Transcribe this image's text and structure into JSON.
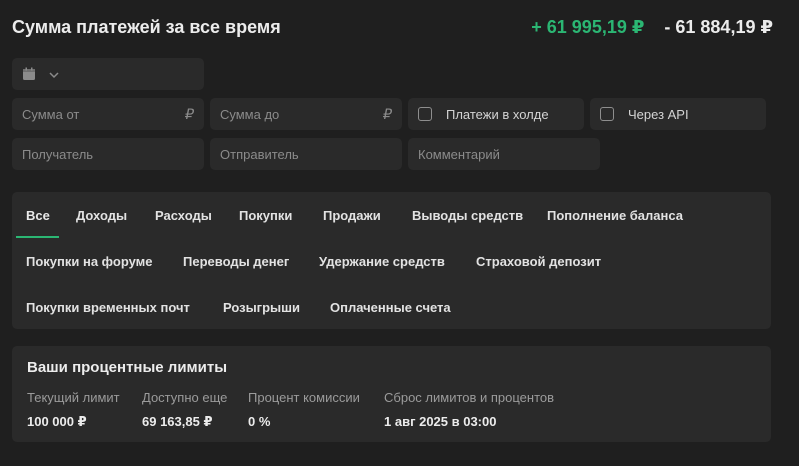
{
  "header": {
    "title": "Сумма платежей за все время",
    "income": "+ 61 995,19 ₽",
    "expense": "- 61 884,19 ₽"
  },
  "filters": {
    "date_icon": "calendar-icon",
    "chevron_icon": "chevron-down-icon",
    "amount_from": {
      "placeholder": "Сумма от",
      "suffix": "₽"
    },
    "amount_to": {
      "placeholder": "Сумма до",
      "suffix": "₽"
    },
    "hold_label": "Платежи в холде",
    "api_label": "Через API",
    "recipient": {
      "placeholder": "Получатель"
    },
    "sender": {
      "placeholder": "Отправитель"
    },
    "comment": {
      "placeholder": "Комментарий"
    }
  },
  "tabs": [
    {
      "label": "Все",
      "active": true
    },
    {
      "label": "Доходы"
    },
    {
      "label": "Расходы"
    },
    {
      "label": "Покупки"
    },
    {
      "label": "Продажи"
    },
    {
      "label": "Выводы средств"
    },
    {
      "label": "Пополнение баланса"
    },
    {
      "label": "Покупки на форуме"
    },
    {
      "label": "Переводы денег"
    },
    {
      "label": "Удержание средств"
    },
    {
      "label": "Страховой депозит"
    },
    {
      "label": "Покупки временных почт"
    },
    {
      "label": "Розыгрыши"
    },
    {
      "label": "Оплаченные счета"
    }
  ],
  "limits": {
    "title": "Ваши процентные лимиты",
    "items": [
      {
        "label": "Текущий лимит",
        "value": "100 000 ₽"
      },
      {
        "label": "Доступно еще",
        "value": "69 163,85 ₽"
      },
      {
        "label": "Процент комиссии",
        "value": "0 %"
      },
      {
        "label": "Сброс лимитов и процентов",
        "value": "1 авг 2025 в 03:00"
      }
    ]
  },
  "colors": {
    "accent": "#2bb673",
    "background": "#1f1f1f",
    "panel": "#2a2a2a"
  }
}
